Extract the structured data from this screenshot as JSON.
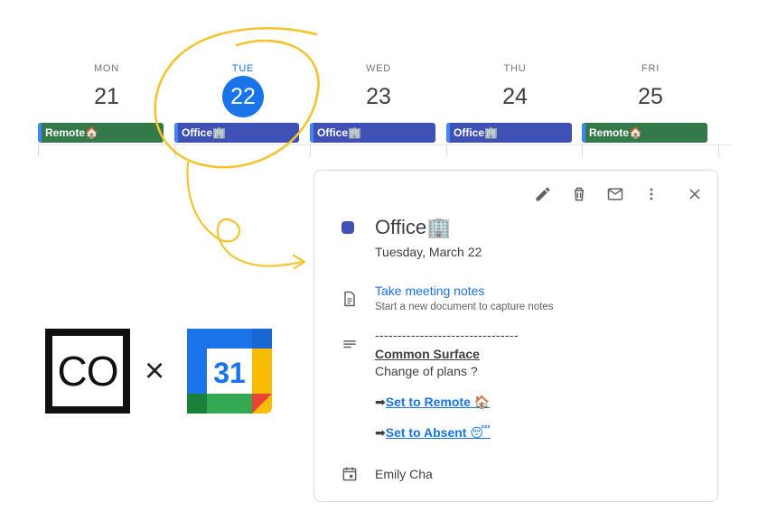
{
  "week": {
    "days": [
      {
        "dow": "MON",
        "num": "21",
        "event": "Remote🏠",
        "type": "remote",
        "today": false
      },
      {
        "dow": "TUE",
        "num": "22",
        "event": "Office🏢",
        "type": "office",
        "today": true
      },
      {
        "dow": "WED",
        "num": "23",
        "event": "Office🏢",
        "type": "office",
        "today": false
      },
      {
        "dow": "THU",
        "num": "24",
        "event": "Office🏢",
        "type": "office",
        "today": false
      },
      {
        "dow": "FRI",
        "num": "25",
        "event": "Remote🏠",
        "type": "remote",
        "today": false
      }
    ]
  },
  "popup": {
    "title": "Office🏢",
    "date": "Tuesday, March 22",
    "notes_link": "Take meeting notes",
    "notes_sub": "Start a new document to capture notes",
    "desc_divider": "--------------------------------",
    "desc_heading": "Common Surface",
    "desc_question": "Change of plans ?",
    "arrow": "➡",
    "link_remote": "Set to Remote 🏠",
    "link_absent": "Set to Absent 😴",
    "organizer": "Emily Cha"
  },
  "logos": {
    "co_text": "CO",
    "times": "×",
    "gcal_number": "31"
  },
  "colors": {
    "remote": "#33794a",
    "office": "#3f51b5",
    "accent": "#1a73e8",
    "annotation": "#f4c430"
  },
  "icons": [
    "edit-icon",
    "delete-icon",
    "email-icon",
    "more-vert-icon",
    "close-icon",
    "notes-doc-icon",
    "description-icon",
    "calendar-icon"
  ]
}
